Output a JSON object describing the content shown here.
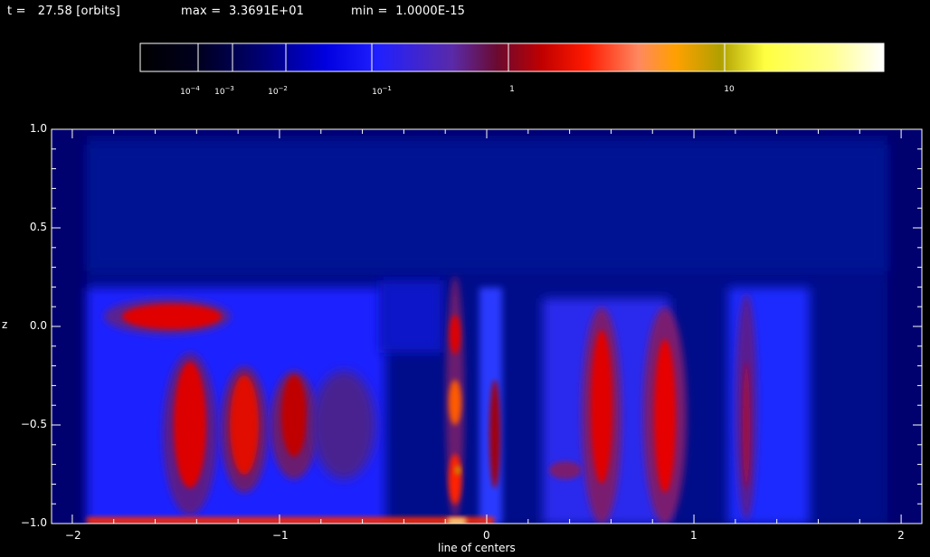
{
  "header": {
    "time_text": "t =   27.58 [orbits]",
    "max_text": "max =  3.3691E+01",
    "min_text": "min =  1.0000E-15"
  },
  "colorbar": {
    "scale": "log",
    "labels": [
      {
        "base": "10",
        "exp": "−4",
        "value": 0.0001
      },
      {
        "base": "10",
        "exp": "−3",
        "value": 0.001
      },
      {
        "base": "10",
        "exp": "−2",
        "value": 0.01
      },
      {
        "base": "10",
        "exp": "−1",
        "value": 0.1
      },
      {
        "base": "1",
        "exp": "",
        "value": 1
      },
      {
        "base": "10",
        "exp": "",
        "value": 10
      }
    ],
    "colormap": [
      "#000000",
      "#000030",
      "#0000a0",
      "#1515ff",
      "#4a28d0",
      "#6a1050",
      "#a00000",
      "#ff1010",
      "#ff8844",
      "#ffa000",
      "#b0b000",
      "#ffff30",
      "#ffff90",
      "#ffffff"
    ]
  },
  "plot": {
    "xlabel": "line of centers",
    "ylabel": "z",
    "xlim": [
      -2.1,
      2.1
    ],
    "ylim": [
      -1.0,
      1.0
    ],
    "x_ticks": [
      "−2",
      "−1",
      "0",
      "1",
      "2"
    ],
    "y_ticks": [
      "1.0",
      "0.5",
      "0.0",
      "−0.5",
      "−1.0"
    ],
    "background_color": "#00007a"
  }
}
